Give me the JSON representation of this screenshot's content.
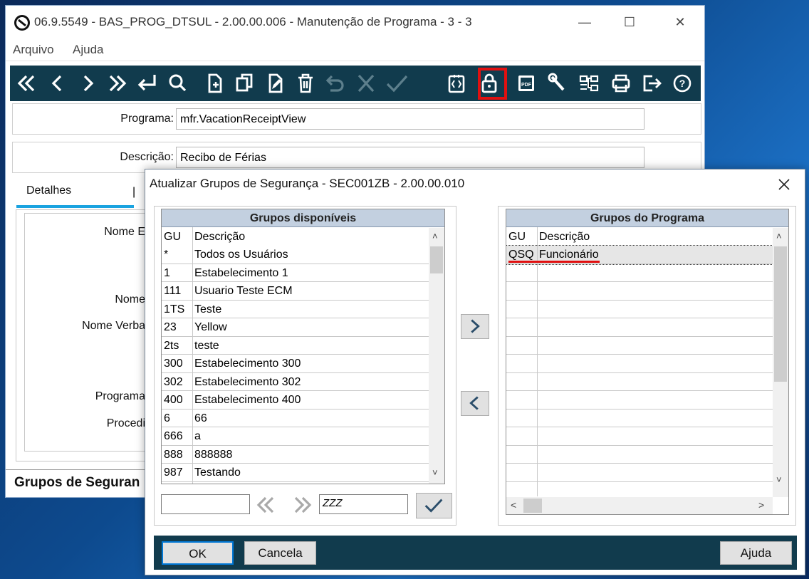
{
  "window": {
    "title": "06.9.5549 - BAS_PROG_DTSUL - 2.00.00.006 - Manutenção de Programa - 3 - 3",
    "minimize": "—",
    "maximize": "☐",
    "close": "✕"
  },
  "menu": {
    "arquivo": "Arquivo",
    "ajuda": "Ajuda"
  },
  "form": {
    "programa_label": "Programa:",
    "programa_value": "mfr.VacationReceiptView",
    "descricao_label": "Descrição:",
    "descricao_value": "Recibo de Férias",
    "tab_detalhes": "Detalhes",
    "label_nome_e": "Nome E",
    "label_nome": "Nome",
    "label_nome_verba": "Nome Verba",
    "label_programa": "Programa",
    "label_procedi": "Procedi",
    "bottom_section": "Grupos de Seguran"
  },
  "dialog": {
    "title": "Atualizar Grupos de Segurança - SEC001ZB - 2.00.00.010",
    "available": {
      "header": "Grupos disponíveis",
      "col_gu": "GU",
      "col_desc": "Descrição",
      "rows": [
        {
          "gu": "*",
          "desc": "Todos os Usuários"
        },
        {
          "gu": "1",
          "desc": "Estabelecimento 1"
        },
        {
          "gu": "111",
          "desc": "Usuario Teste ECM"
        },
        {
          "gu": "1TS",
          "desc": "Teste"
        },
        {
          "gu": "23",
          "desc": "Yellow"
        },
        {
          "gu": "2ts",
          "desc": "teste"
        },
        {
          "gu": "300",
          "desc": "Estabelecimento 300"
        },
        {
          "gu": "302",
          "desc": "Estabelecimento 302"
        },
        {
          "gu": "400",
          "desc": "Estabelecimento 400"
        },
        {
          "gu": "6",
          "desc": "66"
        },
        {
          "gu": "666",
          "desc": "a"
        },
        {
          "gu": "888",
          "desc": "888888"
        },
        {
          "gu": "987",
          "desc": "Testando"
        }
      ]
    },
    "program": {
      "header": "Grupos do Programa",
      "col_gu": "GU",
      "col_desc": "Descrição",
      "rows": [
        {
          "gu": "QSQ",
          "desc": "Funcionário"
        }
      ]
    },
    "filter_from": "",
    "filter_to": "ZZZ",
    "ok": "OK",
    "cancel": "Cancela",
    "help": "Ajuda"
  },
  "colors": {
    "toolbar": "#113b4d",
    "tab_accent": "#1aa3e0",
    "highlight": "#e01010",
    "list_header": "#c3d0e0"
  },
  "icons": [
    "first-icon",
    "prev-icon",
    "next-icon",
    "last-icon",
    "goto-icon",
    "search-icon",
    "new-icon",
    "copy-icon",
    "edit-icon",
    "delete-icon",
    "undo-icon",
    "cancel-icon",
    "confirm-icon",
    "embed-icon",
    "lock-icon",
    "pdf-icon",
    "tools-icon",
    "tree-icon",
    "print-icon",
    "exit-icon",
    "help-icon"
  ]
}
